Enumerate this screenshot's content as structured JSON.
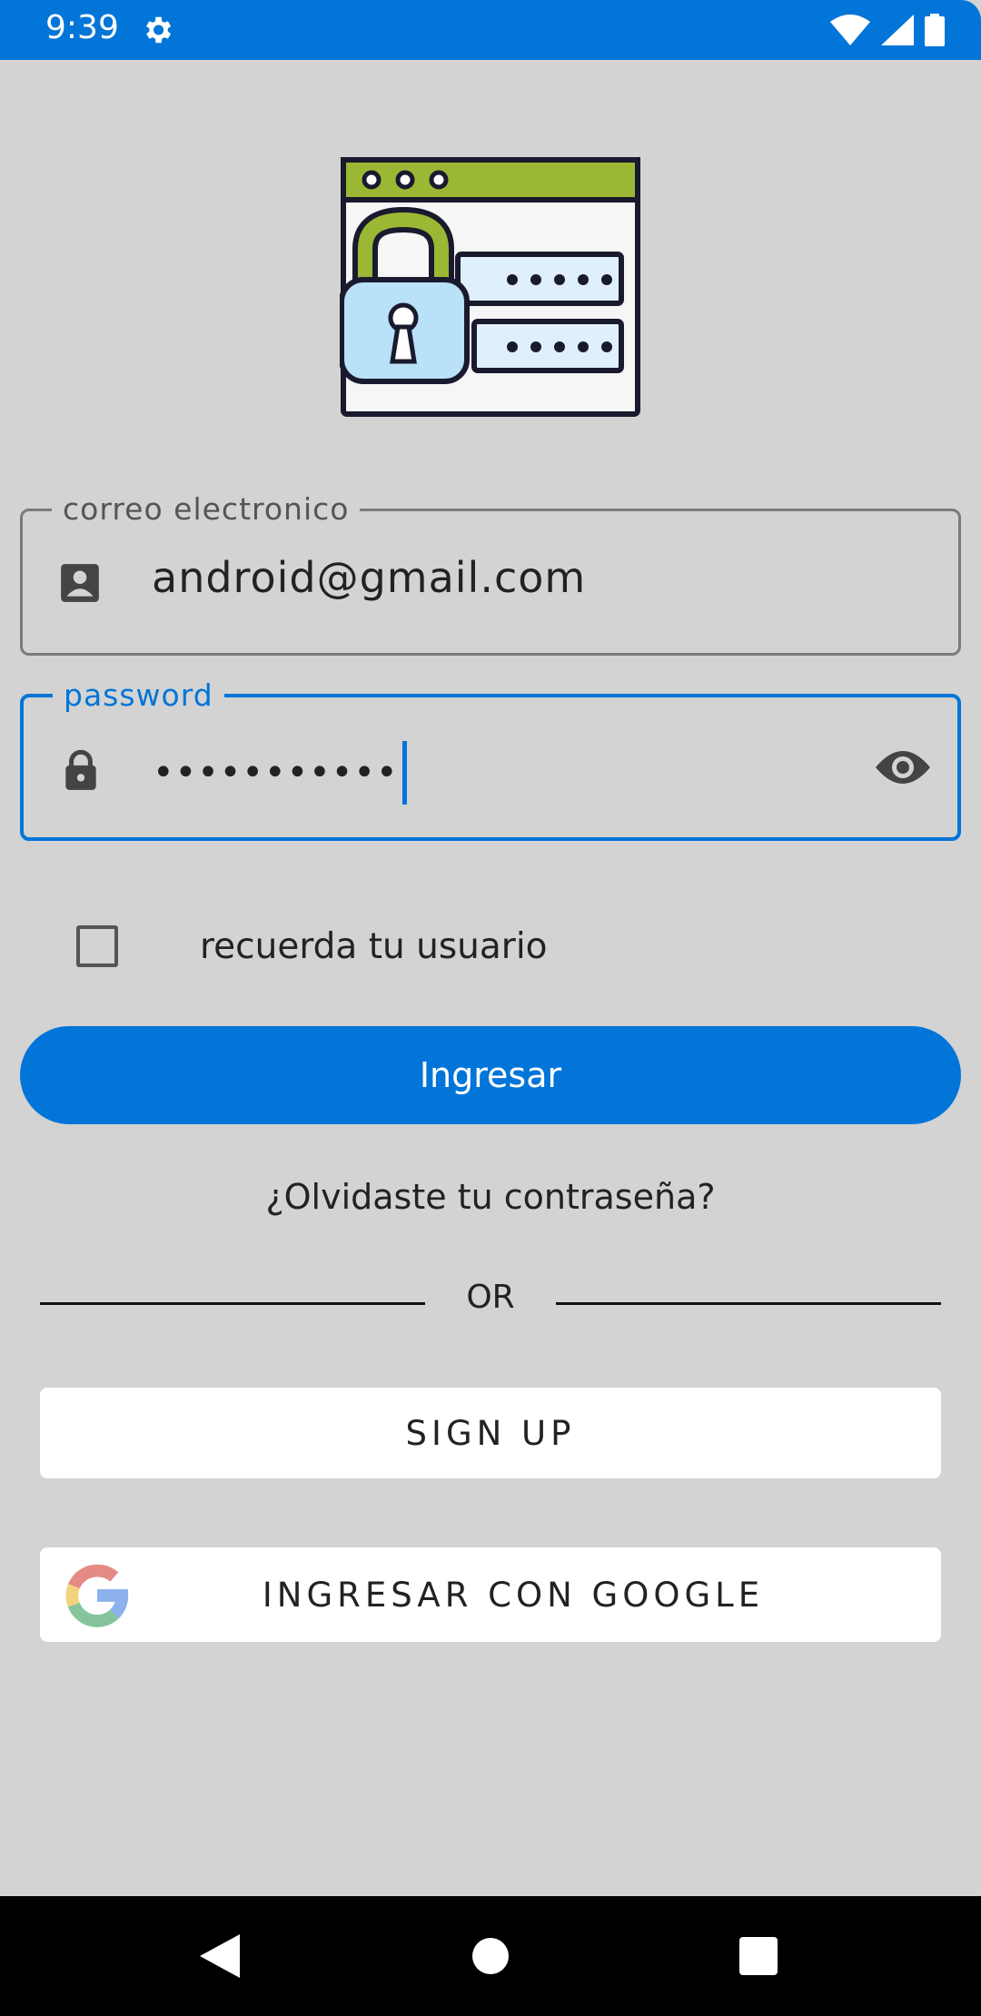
{
  "status_bar": {
    "time": "9:39",
    "icons": [
      "gear-icon",
      "wifi-icon",
      "signal-icon",
      "battery-icon"
    ]
  },
  "form": {
    "email": {
      "label": "correo electronico",
      "value": "android@gmail.com",
      "icon": "contact-card-icon"
    },
    "password": {
      "label": "password",
      "value": "•••••••••••",
      "icon": "lock-icon",
      "toggle_icon": "eye-icon"
    },
    "remember": {
      "label": "recuerda tu usuario",
      "checked": false
    }
  },
  "buttons": {
    "login": "Ingresar",
    "forgot": "¿Olvidaste tu contraseña?",
    "or": "OR",
    "signup": "SIGN UP",
    "google": "INGRESAR CON GOOGLE"
  },
  "colors": {
    "accent": "#0275d8",
    "background": "#d3d3d3"
  },
  "nav_bar": {
    "icons": [
      "back-icon",
      "home-icon",
      "recents-icon"
    ]
  }
}
